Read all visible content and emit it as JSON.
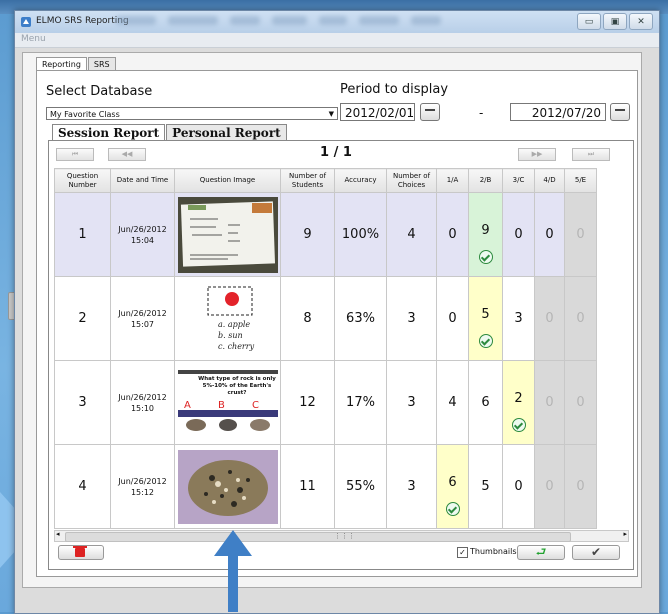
{
  "window": {
    "title": "ELMO SRS Reporting",
    "menu": "Menu"
  },
  "top_tabs": [
    "Reporting",
    "SRS"
  ],
  "database": {
    "label": "Select Database",
    "selected": "My Favorite Class"
  },
  "period": {
    "label": "Period to display",
    "start": "2012/02/01",
    "separator": "-",
    "end": "2012/07/20"
  },
  "report_tabs": [
    "Session Report",
    "Personal Report"
  ],
  "pagination": "1 / 1",
  "table": {
    "headers": [
      "Question Number",
      "Date and Time",
      "Question Image",
      "Number of Students",
      "Accuracy",
      "Number of Choices",
      "1/A",
      "2/B",
      "3/C",
      "4/D",
      "5/E"
    ],
    "rows": [
      {
        "number": "1",
        "date": "Jun/26/2012",
        "time": "15:04",
        "image": "worksheet-photo",
        "students": "9",
        "accuracy": "100%",
        "choices": "4",
        "answers": [
          "0",
          "9",
          "0",
          "0",
          "0"
        ],
        "correct_index": 1
      },
      {
        "number": "2",
        "date": "Jun/26/2012",
        "time": "15:07",
        "image": "handwritten-sketch",
        "students": "8",
        "accuracy": "63%",
        "choices": "3",
        "answers": [
          "0",
          "5",
          "3",
          "0",
          "0"
        ],
        "correct_index": 1
      },
      {
        "number": "3",
        "date": "Jun/26/2012",
        "time": "15:10",
        "image": "rock-types-slide",
        "students": "12",
        "accuracy": "17%",
        "choices": "3",
        "answers": [
          "4",
          "6",
          "2",
          "0",
          "0"
        ],
        "correct_index": 2
      },
      {
        "number": "4",
        "date": "Jun/26/2012",
        "time": "15:12",
        "image": "rock-closeup-photo",
        "students": "11",
        "accuracy": "55%",
        "choices": "3",
        "answers": [
          "6",
          "5",
          "0",
          "0",
          "0"
        ],
        "correct_index": 0
      }
    ]
  },
  "slide": {
    "heading": "What type of rock is only 5%-10% of the Earth's crust?",
    "options": [
      "A",
      "B",
      "C"
    ]
  },
  "sketch": {
    "lines": [
      "a. apple",
      "b. sun",
      "c. cherry"
    ]
  },
  "footer": {
    "thumbnails_label": "Thumbnails",
    "thumbnails_checked": true
  },
  "colors": {
    "correct": "#d8f3d8",
    "selected_highlight": "#ffffc9",
    "inactive": "#d9d9d9",
    "row_selected": "#e3e3f4",
    "arrow": "#3f7fc6"
  }
}
